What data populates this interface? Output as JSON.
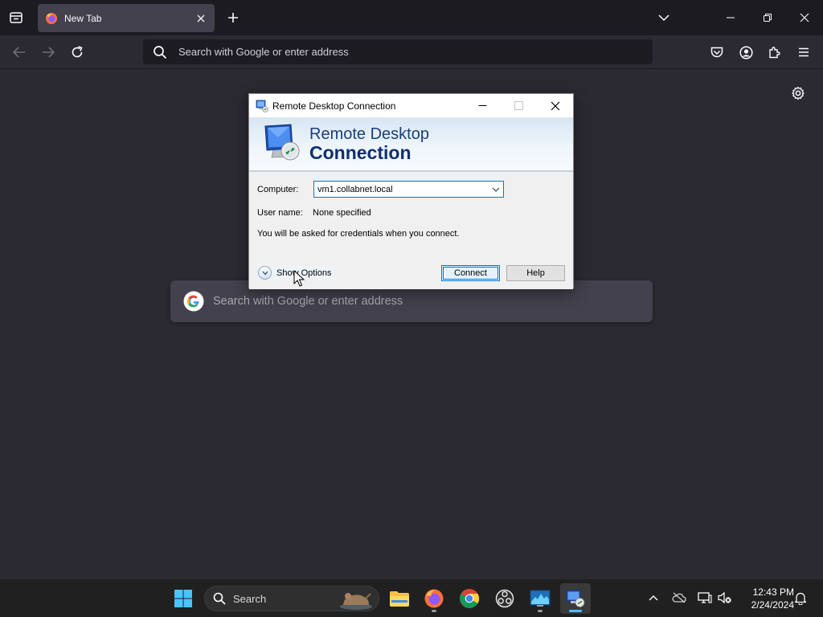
{
  "browser": {
    "tab": {
      "title": "New Tab"
    },
    "urlbar": {
      "placeholder": "Search with Google or enter address"
    }
  },
  "newtab": {
    "search_placeholder": "Search with Google or enter address"
  },
  "dialog": {
    "title": "Remote Desktop Connection",
    "banner_line1": "Remote Desktop",
    "banner_line2": "Connection",
    "computer_label": "Computer:",
    "computer_value": "vm1.collabnet.local",
    "username_label": "User name:",
    "username_value": "None specified",
    "info_text": "You will be asked for credentials when you connect.",
    "show_options_label": "Show Options",
    "connect_label": "Connect",
    "help_label": "Help"
  },
  "taskbar": {
    "search_label": "Search",
    "time": "12:43 PM",
    "date": "2/24/2024"
  },
  "colors": {
    "browser_bg": "#2b2a33",
    "tabstrip_bg": "#1c1b22",
    "taskbar_bg": "#202020",
    "accent": "#0078d7",
    "banner_text": "#0f2f6e"
  }
}
